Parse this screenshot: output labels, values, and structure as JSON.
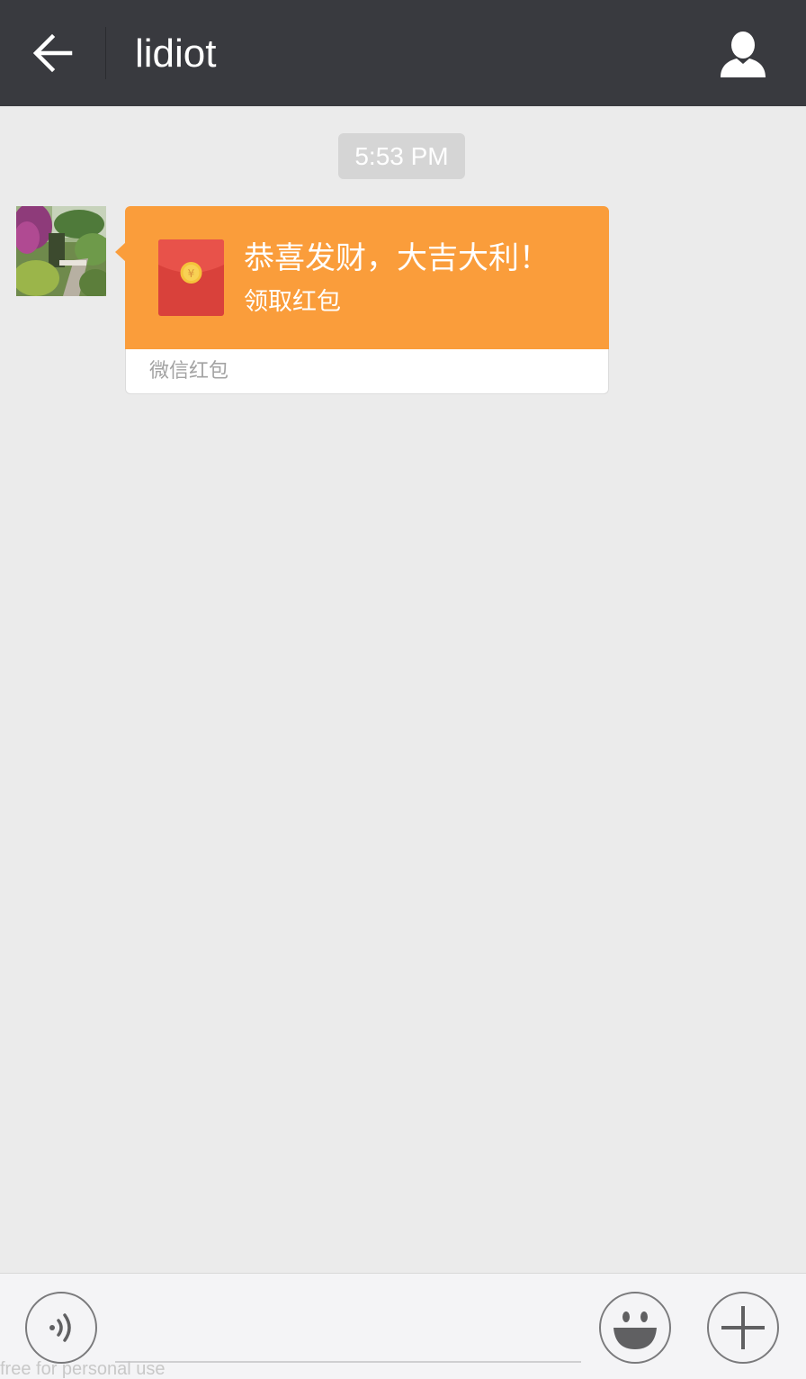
{
  "header": {
    "back_icon": "back-arrow-icon",
    "title": "lidiot",
    "profile_icon": "person-icon"
  },
  "chat": {
    "timestamp": "5:53 PM",
    "messages": [
      {
        "type": "red-packet",
        "sender": "contact",
        "greeting": "恭喜发财，大吉大利！",
        "claim_label": "领取红包",
        "footer_label": "微信红包",
        "envelope_icon": "red-envelope-icon",
        "colors": {
          "bubble": "#fa9d3b",
          "envelope": "#d9413b",
          "coin": "#f5c33b"
        }
      }
    ]
  },
  "input_bar": {
    "voice_icon": "voice-input-icon",
    "emoji_icon": "smiley-emoji-icon",
    "more_icon": "plus-icon"
  },
  "watermark": "free for personal use"
}
